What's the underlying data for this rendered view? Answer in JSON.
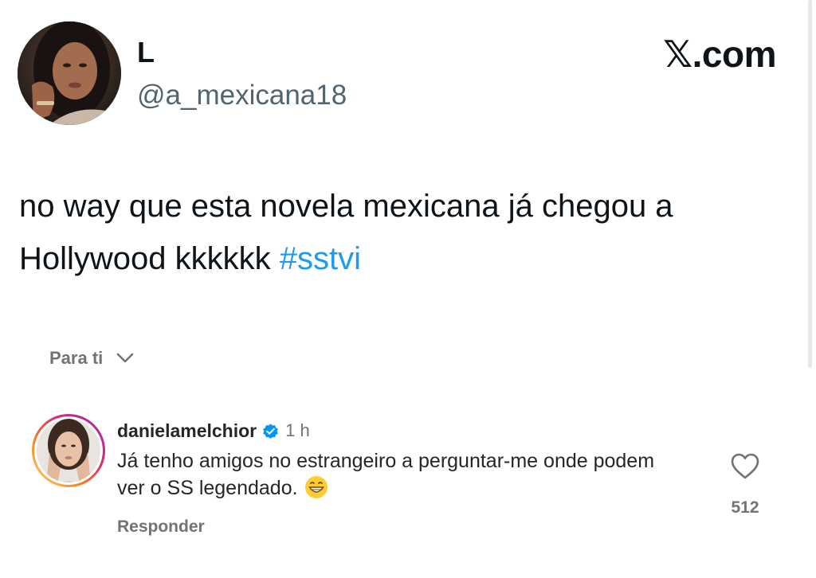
{
  "tweet": {
    "author_name": "L",
    "author_handle": "@a_mexicana18",
    "brand": "𝕏.com",
    "text_main": "no way que esta novela mexicana já chegou a Hollywood kkkkkk",
    "hashtag": "#sstvi",
    "avatar": "profile-photo",
    "hashtag_color": "#1d9bf0"
  },
  "filter": {
    "label": "Para ti",
    "icon": "chevron-down-icon"
  },
  "comment": {
    "username": "danielamelchior",
    "verified_icon": "verified-badge-icon",
    "time": "1 h",
    "text": "Já tenho amigos no estrangeiro a perguntar-me onde podem ver o SS legendado.",
    "emoji": "grinning-face-emoji",
    "reply_label": "Responder",
    "like_icon": "heart-icon",
    "like_count": "512",
    "verified_color": "#0095f6"
  }
}
